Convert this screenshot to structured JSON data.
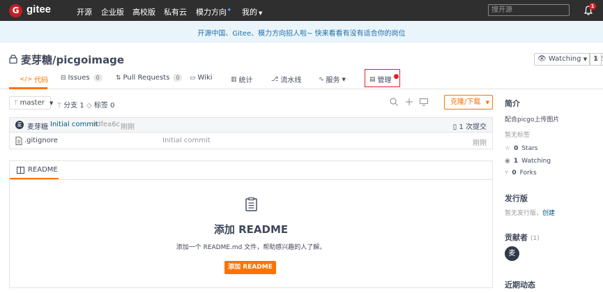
{
  "topnav": {
    "logo_letter": "G",
    "logo_text": "gitee",
    "links": [
      "开源",
      "企业版",
      "高校版",
      "私有云",
      "模力方向",
      "我的"
    ],
    "search_placeholder": "搜开源",
    "notification_count": "1"
  },
  "banner": {
    "text": "开源中国、Gitee、模力方向招人啦~ 快来看看有没有适合你的岗位"
  },
  "repo": {
    "title": "麦芽糖/picgoimage",
    "watching_label": "Watching",
    "watching_count": "1",
    "star_label": "S"
  },
  "tabs": [
    {
      "label": "代码",
      "count": null
    },
    {
      "label": "Issues",
      "count": "0"
    },
    {
      "label": "Pull Requests",
      "count": "0"
    },
    {
      "label": "Wiki",
      "count": null
    },
    {
      "label": "统计",
      "count": null
    },
    {
      "label": "流水线",
      "count": null
    },
    {
      "label": "服务",
      "count": null
    },
    {
      "label": "管理",
      "count": null
    }
  ],
  "branch": {
    "name": "master",
    "branches": "分支 1",
    "tags": "标签 0",
    "clone_label": "克隆/下载"
  },
  "commit": {
    "avatar": "麦",
    "author": "麦芽糖",
    "message": "Initial commit",
    "hash": "edfea6c",
    "time": "刚刚",
    "count": "1 次提交"
  },
  "files": [
    {
      "name": ".gitignore",
      "commit": "Initial commit",
      "time": "刚刚"
    }
  ],
  "readme": {
    "tab_label": "README",
    "title": "添加 README",
    "desc": "添加一个 README.md 文件，帮助感兴趣的人了解。",
    "button": "添加 README"
  },
  "sidebar": {
    "intro_title": "简介",
    "intro_desc": "配合picgo上传图片",
    "no_tags": "暂无标签",
    "stars": {
      "count": "0",
      "label": "Stars"
    },
    "watching": {
      "count": "1",
      "label": "Watching"
    },
    "forks": {
      "count": "0",
      "label": "Forks"
    },
    "release_title": "发行版",
    "release_none": "暂无发行版，",
    "release_create": "创建",
    "contributors_title": "贡献者",
    "contributors_count": "(1)",
    "contributor_avatar": "麦",
    "activity_title": "近期动态"
  },
  "colors": {
    "accent": "#fe7300",
    "nav_bg": "#2f2f2f",
    "banner_bg": "#eaf5fb",
    "link": "#005980"
  }
}
